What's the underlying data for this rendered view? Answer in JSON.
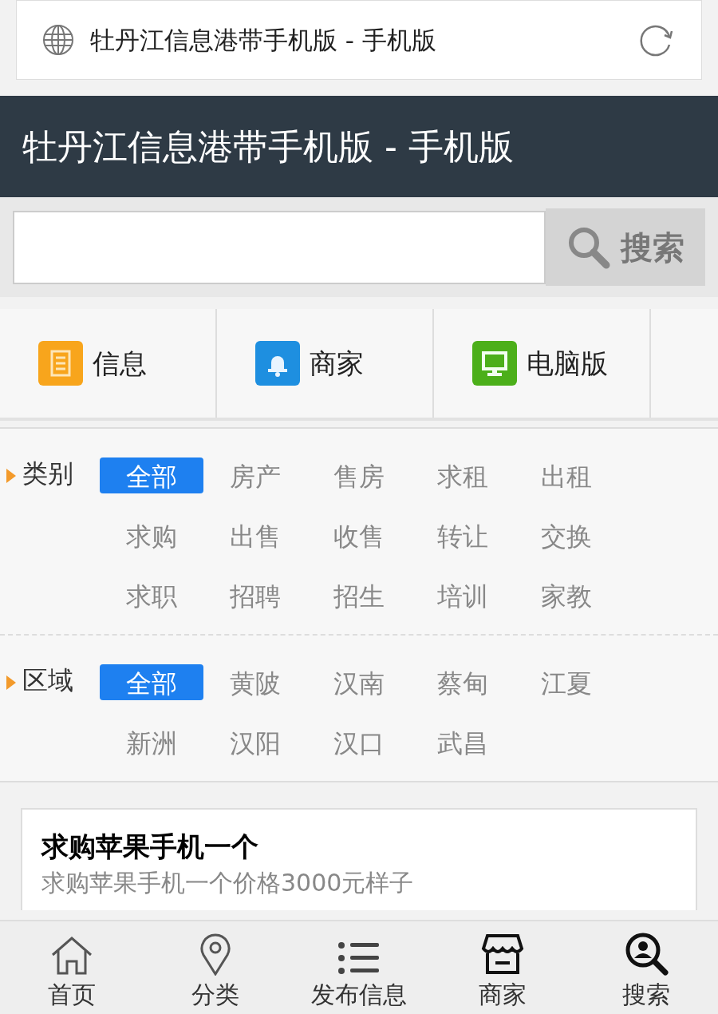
{
  "address_bar": {
    "title": "牡丹江信息港带手机版 - 手机版"
  },
  "header": {
    "title": "牡丹江信息港带手机版 - 手机版"
  },
  "search": {
    "button": "搜索"
  },
  "nav": [
    {
      "kind": "info",
      "label": "信息"
    },
    {
      "kind": "shop",
      "label": "商家"
    },
    {
      "kind": "pc",
      "label": "电脑版"
    }
  ],
  "filters": [
    {
      "label": "类别",
      "options": [
        {
          "label": "全部",
          "selected": true
        },
        {
          "label": "房产",
          "selected": false
        },
        {
          "label": "售房",
          "selected": false
        },
        {
          "label": "求租",
          "selected": false
        },
        {
          "label": "出租",
          "selected": false
        },
        {
          "label": "求购",
          "selected": false
        },
        {
          "label": "出售",
          "selected": false
        },
        {
          "label": "收售",
          "selected": false
        },
        {
          "label": "转让",
          "selected": false
        },
        {
          "label": "交换",
          "selected": false
        },
        {
          "label": "求职",
          "selected": false
        },
        {
          "label": "招聘",
          "selected": false
        },
        {
          "label": "招生",
          "selected": false
        },
        {
          "label": "培训",
          "selected": false
        },
        {
          "label": "家教",
          "selected": false
        }
      ]
    },
    {
      "label": "区域",
      "options": [
        {
          "label": "全部",
          "selected": true
        },
        {
          "label": "黄陂",
          "selected": false
        },
        {
          "label": "汉南",
          "selected": false
        },
        {
          "label": "蔡甸",
          "selected": false
        },
        {
          "label": "江夏",
          "selected": false
        },
        {
          "label": "新洲",
          "selected": false
        },
        {
          "label": "汉阳",
          "selected": false
        },
        {
          "label": "汉口",
          "selected": false
        },
        {
          "label": "武昌",
          "selected": false
        }
      ]
    }
  ],
  "post": {
    "title": "求购苹果手机一个",
    "description": "求购苹果手机一个价格3000元样子"
  },
  "tab_bar": [
    {
      "kind": "home",
      "label": "首页"
    },
    {
      "kind": "pin",
      "label": "分类"
    },
    {
      "kind": "list",
      "label": "发布信息"
    },
    {
      "kind": "store",
      "label": "商家"
    },
    {
      "kind": "search",
      "label": "搜索"
    }
  ]
}
